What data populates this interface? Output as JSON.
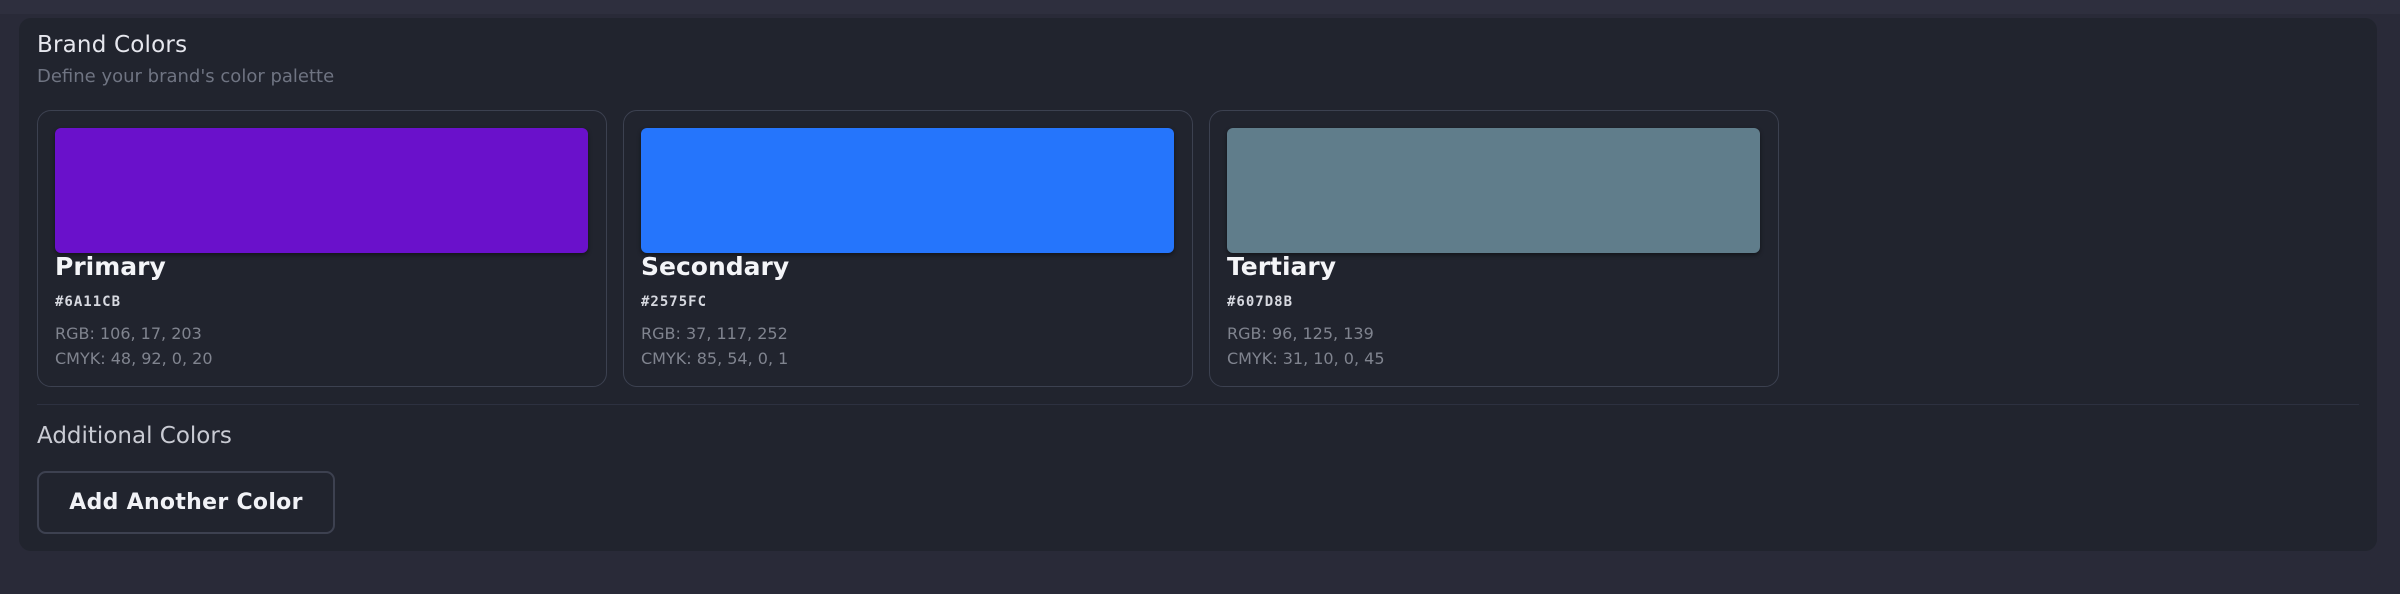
{
  "header": {
    "title": "Brand Colors",
    "subtitle": "Define your brand's color palette"
  },
  "colors": [
    {
      "name": "Primary",
      "hex": "#6A11CB",
      "rgb": "RGB: 106, 17, 203",
      "cmyk": "CMYK: 48, 92, 0, 20",
      "swatch_color": "#6A11CB"
    },
    {
      "name": "Secondary",
      "hex": "#2575FC",
      "rgb": "RGB: 37, 117, 252",
      "cmyk": "CMYK: 85, 54, 0, 1",
      "swatch_color": "#2575FC"
    },
    {
      "name": "Tertiary",
      "hex": "#607D8B",
      "rgb": "RGB: 96, 125, 139",
      "cmyk": "CMYK: 31, 10, 0, 45",
      "swatch_color": "#607D8B"
    }
  ],
  "additional": {
    "heading": "Additional Colors",
    "add_button_label": "Add Another Color"
  }
}
